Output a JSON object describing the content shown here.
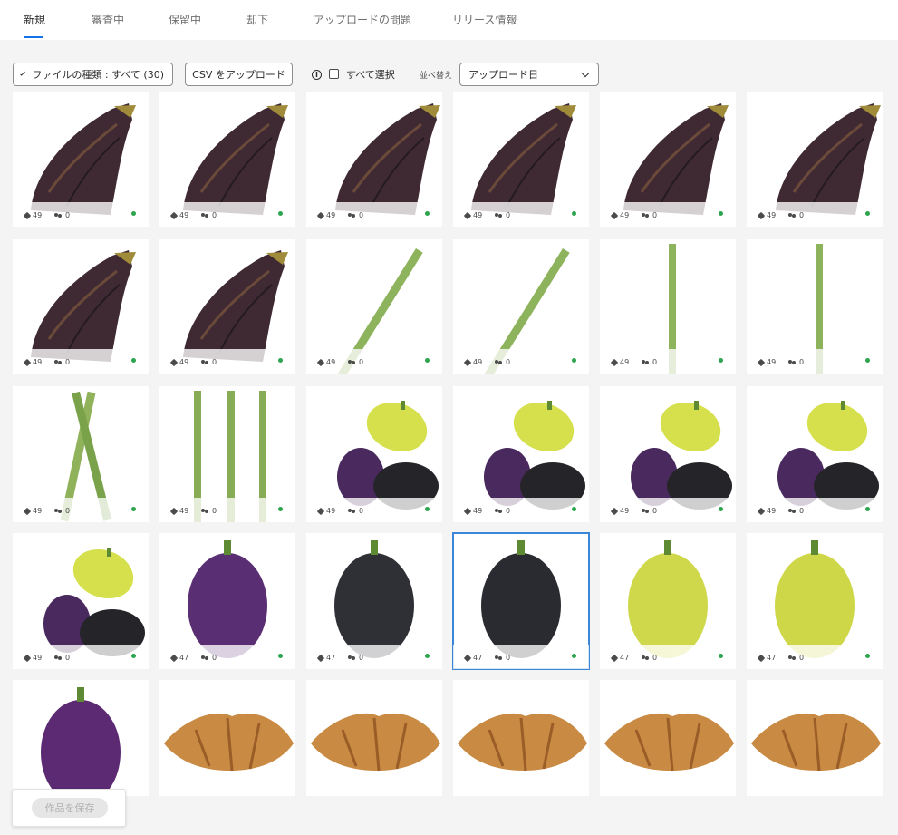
{
  "tabs": [
    {
      "label": "新規",
      "active": true
    },
    {
      "label": "審査中",
      "active": false
    },
    {
      "label": "保留中",
      "active": false
    },
    {
      "label": "却下",
      "active": false
    },
    {
      "label": "アップロードの問題",
      "active": false
    },
    {
      "label": "リリース情報",
      "active": false
    }
  ],
  "toolbar": {
    "file_type_filter": "ファイルの種類 : すべて (30)",
    "csv_upload": "CSV をアップロード",
    "select_all": "すべて選択",
    "sort_label": "並べ替え",
    "sort_value": "アップロード日"
  },
  "colors": {
    "accent": "#1473e6",
    "status_ok": "#2da44e",
    "selected_border": "#3b87d6"
  },
  "assets": [
    {
      "subject": "eggplant",
      "keywords": "49",
      "people": "0"
    },
    {
      "subject": "eggplant",
      "keywords": "49",
      "people": "0"
    },
    {
      "subject": "eggplant",
      "keywords": "49",
      "people": "0"
    },
    {
      "subject": "eggplant",
      "keywords": "49",
      "people": "0"
    },
    {
      "subject": "eggplant",
      "keywords": "49",
      "people": "0"
    },
    {
      "subject": "eggplant",
      "keywords": "49",
      "people": "0"
    },
    {
      "subject": "eggplant",
      "keywords": "49",
      "people": "0"
    },
    {
      "subject": "eggplant",
      "keywords": "49",
      "people": "0"
    },
    {
      "subject": "asparagus",
      "keywords": "49",
      "people": "0"
    },
    {
      "subject": "asparagus",
      "keywords": "49",
      "people": "0"
    },
    {
      "subject": "asparagus",
      "keywords": "49",
      "people": "0"
    },
    {
      "subject": "asparagus",
      "keywords": "49",
      "people": "0"
    },
    {
      "subject": "asparagus",
      "keywords": "49",
      "people": "0"
    },
    {
      "subject": "asparagus",
      "keywords": "49",
      "people": "0"
    },
    {
      "subject": "peppers",
      "keywords": "49",
      "people": "0"
    },
    {
      "subject": "peppers",
      "keywords": "49",
      "people": "0"
    },
    {
      "subject": "peppers",
      "keywords": "49",
      "people": "0"
    },
    {
      "subject": "peppers",
      "keywords": "49",
      "people": "0"
    },
    {
      "subject": "peppers",
      "keywords": "49",
      "people": "0"
    },
    {
      "subject": "pepper",
      "keywords": "47",
      "people": "0"
    },
    {
      "subject": "pepper",
      "keywords": "47",
      "people": "0"
    },
    {
      "subject": "pepper",
      "keywords": "47",
      "people": "0",
      "selected": true
    },
    {
      "subject": "pepper",
      "keywords": "47",
      "people": "0"
    },
    {
      "subject": "pepper",
      "keywords": "47",
      "people": "0"
    },
    {
      "subject": "pepper",
      "keywords": "",
      "people": ""
    },
    {
      "subject": "croissant",
      "keywords": "",
      "people": ""
    },
    {
      "subject": "croissant",
      "keywords": "",
      "people": ""
    },
    {
      "subject": "croissant",
      "keywords": "",
      "people": ""
    },
    {
      "subject": "croissant",
      "keywords": "",
      "people": ""
    },
    {
      "subject": "croissant",
      "keywords": "",
      "people": ""
    }
  ],
  "save_button": "作品を保存"
}
